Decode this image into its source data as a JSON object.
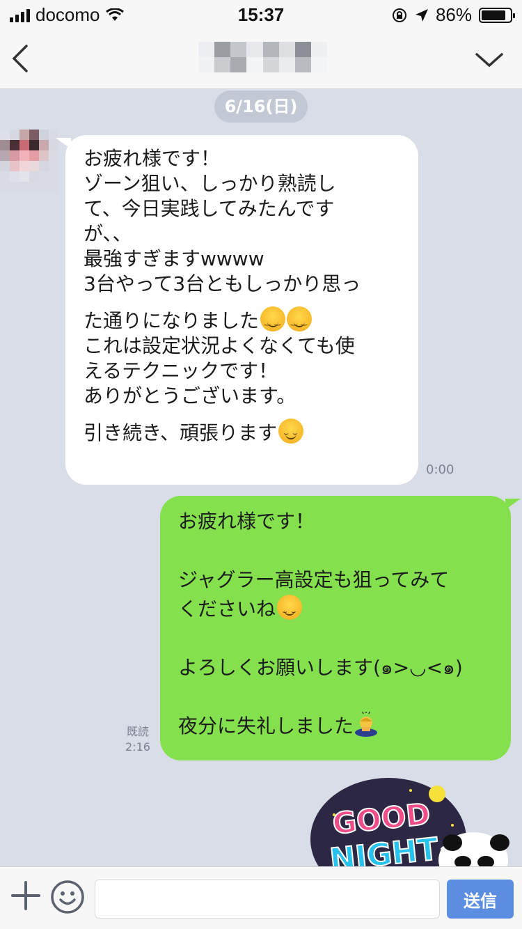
{
  "status_bar": {
    "carrier": "docomo",
    "time": "15:37",
    "battery_text": "86%",
    "battery_level": 0.86,
    "icons": [
      "signal-icon",
      "wifi-icon",
      "orientation-lock-icon",
      "location-icon",
      "battery-icon"
    ]
  },
  "nav": {
    "back_icon": "chevron-left-icon",
    "menu_icon": "chevron-down-icon"
  },
  "chat": {
    "date_label": "6/16(日)",
    "incoming": {
      "lines": [
        "お疲れ様です！",
        "ゾーン狙い、しっかり熟読し",
        "て、今日実践してみたんです",
        "が、、",
        "最強すぎますwwww",
        "3台やって3台ともしっかり思っ",
        "た通りになりました",
        "これは設定状況よくなくても使",
        "えるテクニックです！",
        "ありがとうございます。",
        "引き続き、頑張ります"
      ],
      "time": "0:00"
    },
    "outgoing": {
      "lines": [
        "お疲れ様です！",
        "",
        "ジャグラー高設定も狙ってみて",
        "くださいね",
        "",
        "よろしくお願いします(๑>◡<๑)",
        "",
        "夜分に失礼しました"
      ],
      "read_label": "既読",
      "time": "2:16"
    },
    "sticker": {
      "text_line1": "GOOD",
      "text_line2": "NIGHT~"
    }
  },
  "input_bar": {
    "placeholder": "",
    "send_label": "送信"
  },
  "colors": {
    "chat_bg": "#d8dde7",
    "outgoing_bubble": "#84e14d",
    "incoming_bubble": "#ffffff",
    "send_button": "#5b8ee0"
  }
}
